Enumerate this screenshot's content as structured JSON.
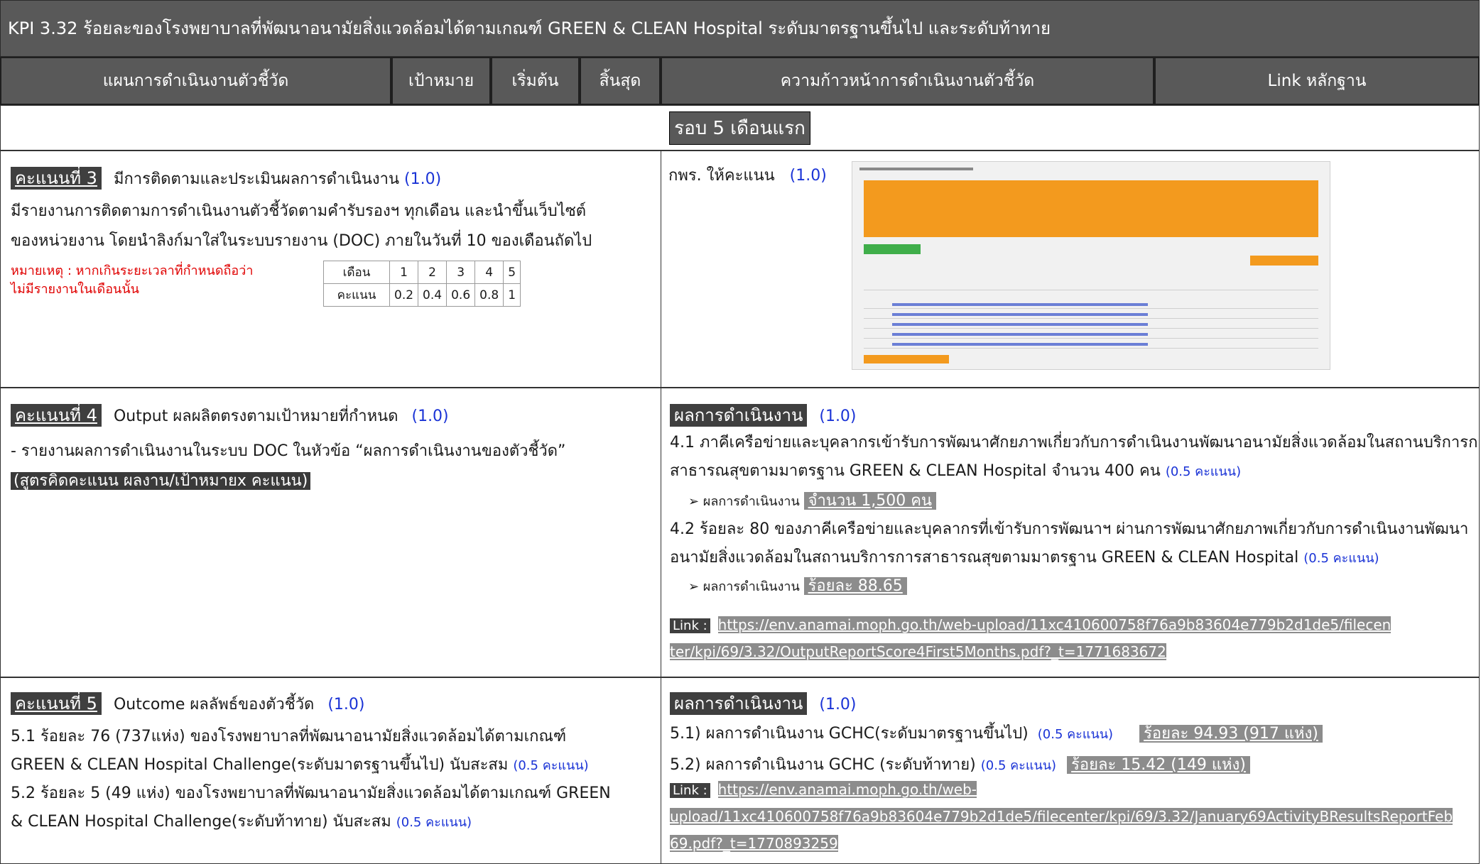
{
  "title": "KPI 3.32 ร้อยละของโรงพยาบาลที่พัฒนาอนามัยสิ่งแวดล้อมได้ตามเกณฑ์ GREEN & CLEAN Hospital ระดับมาตรฐานขึ้นไป และระดับท้าทาย",
  "headers": {
    "plan": "แผนการดำเนินงานตัวชี้วัด",
    "target": "เป้าหมาย",
    "start": "เริ่มต้น",
    "end": "สิ้นสุด",
    "progress": "ความก้าวหน้าการดำเนินงานตัวชี้วัด",
    "evidence": "Link หลักฐาน"
  },
  "round": "รอบ 5 เดือนแรก",
  "score3": {
    "tag": "คะแนนที่ 3",
    "heading": "มีการติดตามและประเมินผลการดำเนินงาน",
    "points": "(1.0)",
    "line1": "มีรายงานการติดตามการดำเนินงานตัวชี้วัดตามคำรับรองฯ ทุกเดือน และนำขึ้นเว็บไซต์",
    "line2": "ของหน่วยงาน โดยนำลิงก์มาใส่ในระบบรายงาน (DOC) ภายในวันที่ 10 ของเดือนถัดไป",
    "note1": "หมายเหตุ : หากเกินระยะเวลาที่กำหนดถือว่า",
    "note2": "ไม่มีรายงานในเดือนนั้น",
    "table": {
      "month_label": "เดือน",
      "months": [
        "1",
        "2",
        "3",
        "4",
        "5"
      ],
      "score_label": "คะแนน",
      "scores": [
        "0.2",
        "0.4",
        "0.6",
        "0.8",
        "1"
      ]
    },
    "progress_label": "กพร. ให้คะแนน",
    "progress_points": "(1.0)"
  },
  "score4": {
    "tag": "คะแนนที่ 4",
    "heading": "Output  ผลผลิตตรงตามเป้าหมายที่กำหนด",
    "points": "(1.0)",
    "line1": "- รายงานผลการดำเนินงานในระบบ DOC ในหัวข้อ “ผลการดำเนินงานของตัวชี้วัด”",
    "formula": "(สูตรคิดคะแนน ผลงาน/เป้าหมายx คะแนน)",
    "result_label": "ผลการดำเนินงาน",
    "result_points": "(1.0)",
    "p1a": "4.1 ภาคีเครือข่ายและบุคลากรเข้ารับการพัฒนาศักยภาพเกี่ยวกับการดำเนินงานพัฒนาอนามัยสิ่งแวดล้อมในสถานบริการการ",
    "p1b": "สาธารณสุขตามมาตรฐาน GREEN & CLEAN Hospital จำนวน 400 คน",
    "p1_points": "(0.5 คะแนน)",
    "r1_label": "➢ ผลการดำเนินงาน",
    "r1_value": "จำนวน  1,500  คน",
    "p2a": "4.2 ร้อยละ 80 ของภาคีเครือข่ายและบุคลากรที่เข้ารับการพัฒนาฯ ผ่านการพัฒนาศักยภาพเกี่ยวกับการดำเนินงานพัฒนา",
    "p2b": "อนามัยสิ่งแวดล้อมในสถานบริการการสาธารณสุขตามมาตรฐาน GREEN & CLEAN Hospital",
    "p2_points": "(0.5 คะแนน)",
    "r2_label": "➢ ผลการดำเนินงาน",
    "r2_value": "ร้อยละ  88.65",
    "link_label": "Link :",
    "link_a": "https://env.anamai.moph.go.th/web-upload/11xc410600758f76a9b83604e779b2d1de5/filecen",
    "link_b": "ter/kpi/69/3.32/OutputReportScore4First5Months.pdf?_t=1771683672"
  },
  "score5": {
    "tag": "คะแนนที่ 5",
    "heading": "Outcome ผลลัพธ์ของตัวชี้วัด",
    "points": "(1.0)",
    "l1": "5.1 ร้อยละ 76 (737แห่ง) ของโรงพยาบาลที่พัฒนาอนามัยสิ่งแวดล้อมได้ตามเกณฑ์",
    "l2": "GREEN & CLEAN Hospital Challenge(ระดับมาตรฐานขึ้นไป) นับสะสม",
    "l2_points": "(0.5 คะแนน)",
    "l3": "5.2 ร้อยละ 5 (49 แห่ง) ของโรงพยาบาลที่พัฒนาอนามัยสิ่งแวดล้อมได้ตามเกณฑ์ GREEN",
    "l4": "& CLEAN Hospital Challenge(ระดับท้าทาย) นับสะสม",
    "l4_points": "(0.5 คะแนน)",
    "result_label": "ผลการดำเนินงาน",
    "result_points": "(1.0)",
    "r1": "5.1)   ผลการดำเนินงาน GCHC(ระดับมาตรฐานขึ้นไป)",
    "r1_points": "(0.5 คะแนน)",
    "r1_value": "ร้อยละ 94.93  (917  แห่ง)",
    "r2": "5.2)   ผลการดำเนินงาน GCHC (ระดับท้าทาย)",
    "r2_points": "(0.5 คะแนน)",
    "r2_value": "ร้อยละ 15.42 (149 แห่ง)",
    "link_label": "Link :",
    "link_a": "https://env.anamai.moph.go.th/web-",
    "link_b": "upload/11xc410600758f76a9b83604e779b2d1de5/filecenter/kpi/69/3.32/January69ActivityBResultsReportFeb",
    "link_c": "69.pdf?_t=1770893259"
  },
  "colors": {
    "header_bg": "#595959",
    "accent_blue": "#1a33d6",
    "note_red": "#e00000",
    "screenshot_orange": "#f39a1e"
  }
}
